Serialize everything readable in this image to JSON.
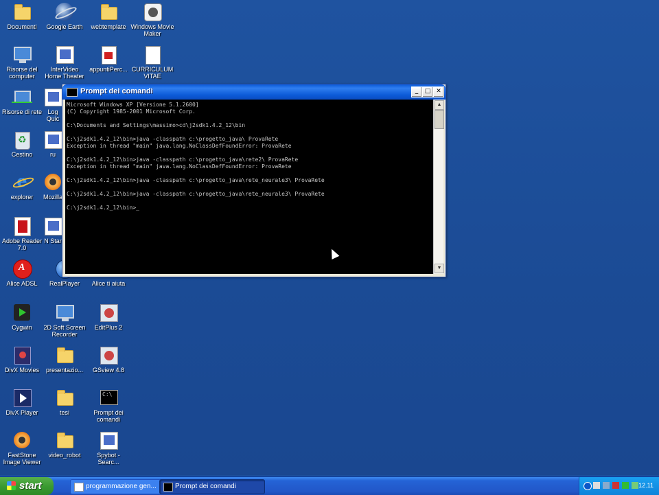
{
  "desktop": {
    "icons": [
      {
        "label": "Documenti"
      },
      {
        "label": "Google Earth"
      },
      {
        "label": "webtemplate"
      },
      {
        "label": "Windows Movie Maker"
      },
      {
        "label": "Risorse del computer"
      },
      {
        "label": "InterVideo Home Theater"
      },
      {
        "label": "appuntiPerc..."
      },
      {
        "label": "CURRICULUM VITAE"
      },
      {
        "label": "Risorse di rete"
      },
      {
        "label": "Log Quic"
      },
      {
        "label": "Cestino"
      },
      {
        "label": "ru"
      },
      {
        "label": "explorer"
      },
      {
        "label": "Mozilla"
      },
      {
        "label": "Adobe Reader 7.0"
      },
      {
        "label": "N Star"
      },
      {
        "label": "Alice ADSL"
      },
      {
        "label": "RealPlayer"
      },
      {
        "label": "Alice ti aiuta"
      },
      {
        "label": "Cygwin"
      },
      {
        "label": "2D Soft Screen Recorder"
      },
      {
        "label": "EditPlus 2"
      },
      {
        "label": "DivX Movies"
      },
      {
        "label": "presentazio..."
      },
      {
        "label": "GSview 4.8"
      },
      {
        "label": "DivX Player"
      },
      {
        "label": "tesi"
      },
      {
        "label": "Prompt dei comandi"
      },
      {
        "label": "FastStone Image Viewer"
      },
      {
        "label": "video_robot"
      },
      {
        "label": "Spybot - Searc..."
      }
    ]
  },
  "cmd_window": {
    "title": "Prompt dei comandi",
    "buttons": {
      "minimize": "_",
      "maximize": "□",
      "close": "✕"
    },
    "console_text": "Microsoft Windows XP [Versione 5.1.2600]\n(C) Copyright 1985-2001 Microsoft Corp.\n\nC:\\Documents and Settings\\massimo>cd\\j2sdk1.4.2_12\\bin\n\nC:\\j2sdk1.4.2_12\\bin>java -classpath c:\\progetto_java\\ ProvaRete\nException in thread \"main\" java.lang.NoClassDefFoundError: ProvaRete\n\nC:\\j2sdk1.4.2_12\\bin>java -classpath c:\\progetto_java\\rete2\\ ProvaRete\nException in thread \"main\" java.lang.NoClassDefFoundError: ProvaRete\n\nC:\\j2sdk1.4.2_12\\bin>java -classpath c:\\progetto_java\\rete_neurale3\\ ProvaRete\n\nC:\\j2sdk1.4.2_12\\bin>java -classpath c:\\progetto_java\\rete_neurale3\\ ProvaRete\n\nC:\\j2sdk1.4.2_12\\bin>_"
  },
  "taskbar": {
    "start_label": "start",
    "tasks": [
      {
        "label": "programmazione gen..."
      },
      {
        "label": "Prompt dei comandi"
      }
    ],
    "clock": "12.11"
  }
}
